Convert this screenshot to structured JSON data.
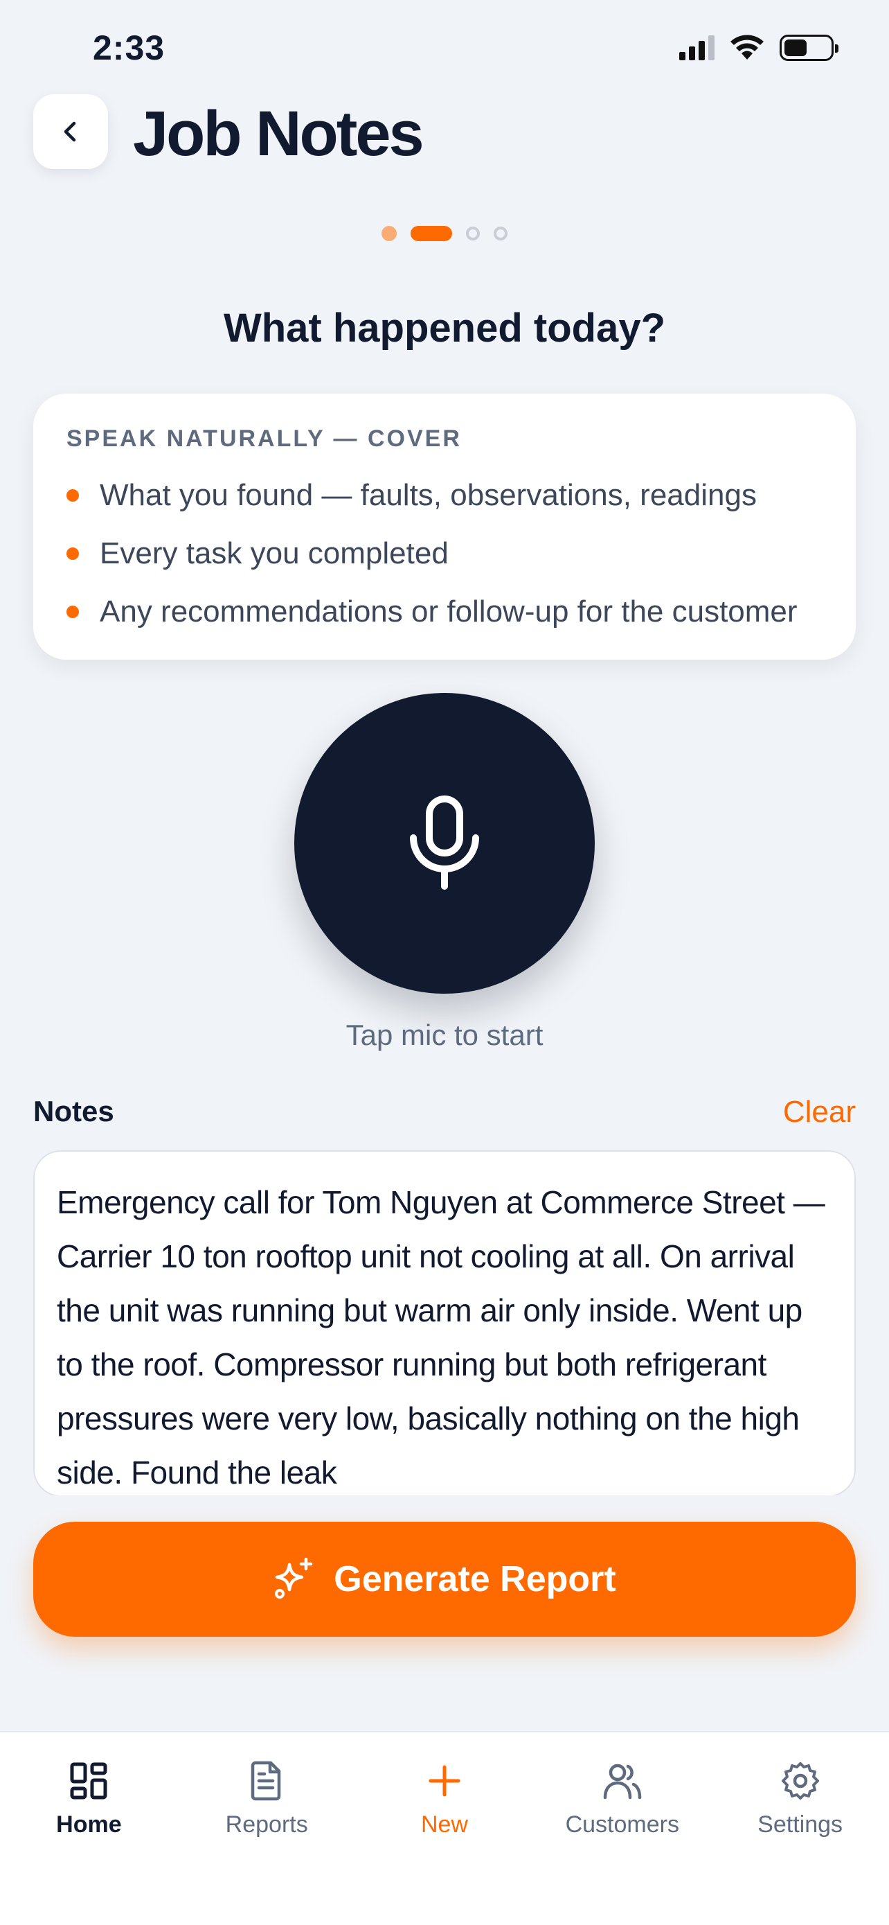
{
  "status_bar": {
    "time": "2:33"
  },
  "header": {
    "title": "Job Notes"
  },
  "stepper": {
    "total": 4,
    "current": 2
  },
  "question": "What happened today?",
  "tips": {
    "heading": "SPEAK NATURALLY — COVER",
    "items": [
      "What you found — faults, observations, readings",
      "Every task you completed",
      "Any recommendations or follow-up for the customer"
    ]
  },
  "mic": {
    "hint": "Tap mic to start"
  },
  "notes": {
    "label": "Notes",
    "clear_label": "Clear",
    "text": "Emergency call for Tom Nguyen at Commerce Street — Carrier 10 ton rooftop unit not cooling at all. On arrival the unit was running but warm air only inside. Went up to the roof. Compressor running but both refrigerant pressures were very low, basically nothing on the high side. Found the leak"
  },
  "generate_button": {
    "label": "Generate Report"
  },
  "tab_bar": {
    "items": [
      {
        "label": "Home",
        "icon": "grid-icon"
      },
      {
        "label": "Reports",
        "icon": "document-icon"
      },
      {
        "label": "New",
        "icon": "plus-icon"
      },
      {
        "label": "Customers",
        "icon": "users-icon"
      },
      {
        "label": "Settings",
        "icon": "gear-icon"
      }
    ]
  },
  "colors": {
    "accent": "#ff6a00",
    "dark": "#111a2e",
    "background": "#f0f3f7"
  }
}
